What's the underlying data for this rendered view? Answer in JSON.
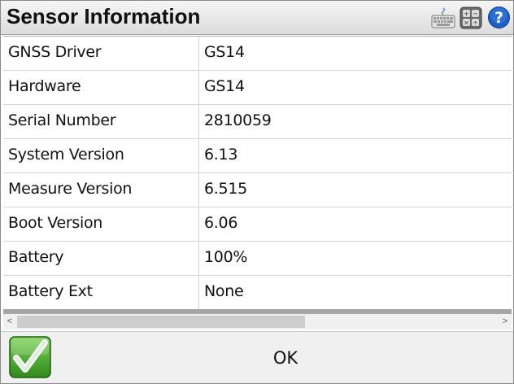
{
  "window": {
    "title": "Sensor Information"
  },
  "toolbar": {
    "icons": [
      "keyboard-icon",
      "calculator-icon",
      "help-icon"
    ]
  },
  "table": {
    "rows": [
      {
        "label": "GNSS Driver",
        "value": "GS14"
      },
      {
        "label": "Hardware",
        "value": "GS14"
      },
      {
        "label": "Serial Number",
        "value": "2810059"
      },
      {
        "label": "System Version",
        "value": "6.13"
      },
      {
        "label": "Measure Version",
        "value": "6.515"
      },
      {
        "label": "Boot Version",
        "value": "6.06"
      },
      {
        "label": "Battery",
        "value": "100%"
      },
      {
        "label": "Battery Ext",
        "value": "None"
      }
    ]
  },
  "scrollbar": {
    "left_arrow": "<",
    "right_arrow": ">"
  },
  "footer": {
    "ok_label": "OK"
  },
  "colors": {
    "accent_green": "#2f9a1f",
    "help_blue": "#1d5fc4"
  }
}
